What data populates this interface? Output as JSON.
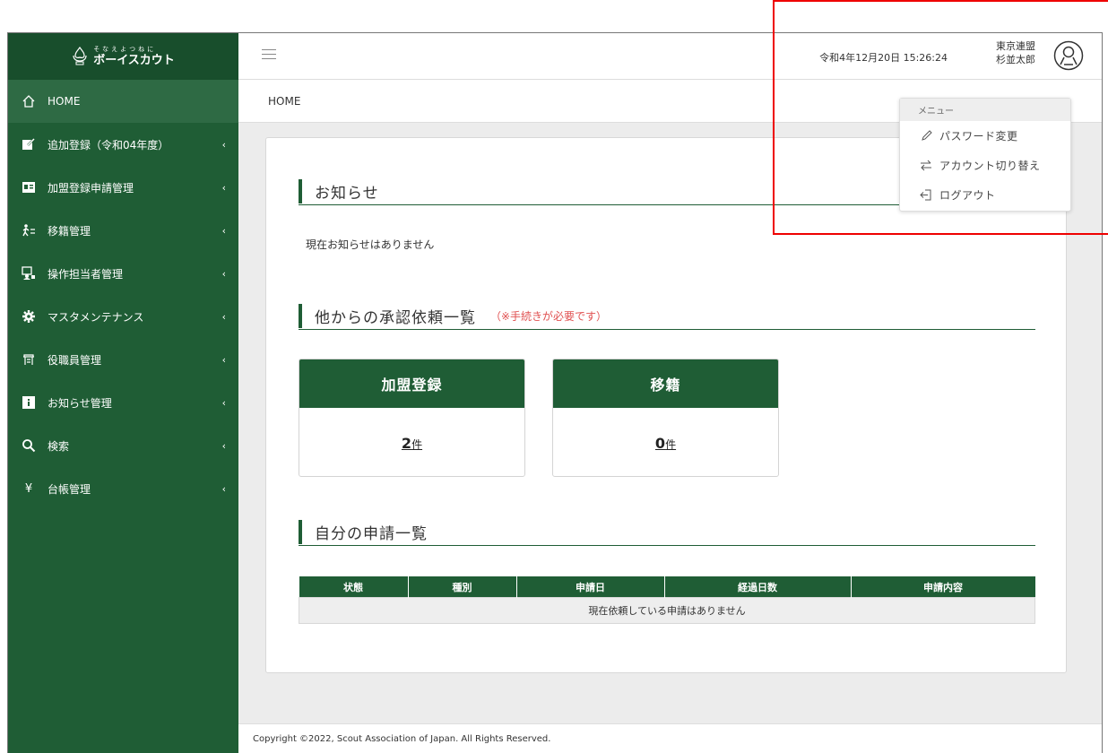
{
  "brand": {
    "logo_sub": "そなえよつねに",
    "logo_main": "ボーイスカウト"
  },
  "sidebar": {
    "items": [
      {
        "label": "HOME",
        "icon": "home-icon",
        "active": true,
        "chevron": false
      },
      {
        "label": "追加登録（令和04年度）",
        "icon": "edit-icon",
        "chevron": true
      },
      {
        "label": "加盟登録申請管理",
        "icon": "id-card-icon",
        "chevron": true
      },
      {
        "label": "移籍管理",
        "icon": "transfer-icon",
        "chevron": true
      },
      {
        "label": "操作担当者管理",
        "icon": "operator-icon",
        "chevron": true
      },
      {
        "label": "マスタメンテナンス",
        "icon": "gear-icon",
        "chevron": true
      },
      {
        "label": "役職員管理",
        "icon": "staff-icon",
        "chevron": true
      },
      {
        "label": "お知らせ管理",
        "icon": "info-icon",
        "chevron": true
      },
      {
        "label": "検索",
        "icon": "search-icon",
        "chevron": true
      },
      {
        "label": "台帳管理",
        "icon": "yen-icon",
        "chevron": true
      }
    ],
    "chevron_glyph": "‹"
  },
  "header": {
    "datetime": "令和4年12月20日 15:26:24",
    "user_org": "東京連盟",
    "user_name": "杉並太郎"
  },
  "breadcrumb": "HOME",
  "notice": {
    "title": "お知らせ",
    "empty_text": "現在お知らせはありません"
  },
  "approvals": {
    "title": "他からの承認依頼一覧",
    "note": "（※手続きが必要です）",
    "cards": [
      {
        "label": "加盟登録",
        "count": "2",
        "unit": "件"
      },
      {
        "label": "移籍",
        "count": "0",
        "unit": "件"
      }
    ]
  },
  "my_apps": {
    "title": "自分の申請一覧",
    "columns": [
      "状態",
      "種別",
      "申請日",
      "経過日数",
      "申請内容"
    ],
    "empty_text": "現在依頼している申請はありません"
  },
  "footer": "Copyright ©2022, Scout Association of Japan. All Rights Reserved.",
  "user_menu": {
    "heading": "メニュー",
    "items": [
      {
        "label": "パスワード変更",
        "icon": "pencil-icon"
      },
      {
        "label": "アカウント切り替え",
        "icon": "switch-icon"
      },
      {
        "label": "ログアウト",
        "icon": "logout-icon"
      }
    ]
  },
  "colors": {
    "brand_green": "#1f5d35",
    "highlight_red": "#e00000",
    "note_red": "#e05050"
  }
}
